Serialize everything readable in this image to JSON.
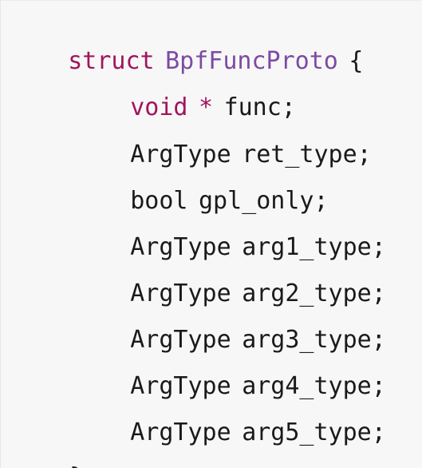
{
  "code": {
    "line0": {
      "keyword": "struct",
      "name": "BpfFuncProto",
      "brace": "{"
    },
    "line1": {
      "keyword": "void",
      "pointer": "*",
      "field": "func;"
    },
    "fields": [
      {
        "type": "ArgType",
        "name": "ret_type;"
      },
      {
        "type": "bool",
        "name": "gpl_only;"
      },
      {
        "type": "ArgType",
        "name": "arg1_type;"
      },
      {
        "type": "ArgType",
        "name": "arg2_type;"
      },
      {
        "type": "ArgType",
        "name": "arg3_type;"
      },
      {
        "type": "ArgType",
        "name": "arg4_type;"
      },
      {
        "type": "ArgType",
        "name": "arg5_type;"
      }
    ],
    "closing": "}"
  },
  "colors": {
    "keyword": "#a0155e",
    "type_name": "#7d4aa3",
    "text": "#1a1a1a",
    "background": "#f7f7f7"
  }
}
